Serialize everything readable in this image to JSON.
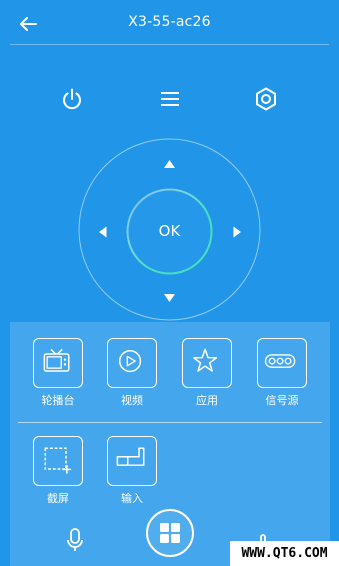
{
  "header": {
    "title": "X3-55-ac26"
  },
  "top_controls": [
    {
      "name": "power-icon"
    },
    {
      "name": "menu-icon"
    },
    {
      "name": "settings-icon"
    }
  ],
  "dpad": {
    "ok_label": "OK"
  },
  "shortcuts": [
    {
      "icon": "tv-icon",
      "label": "轮播台"
    },
    {
      "icon": "video-icon",
      "label": "视频"
    },
    {
      "icon": "star-icon",
      "label": "应用"
    },
    {
      "icon": "signal-source-icon",
      "label": "信号源"
    },
    {
      "icon": "screenshot-icon",
      "label": "截屏"
    },
    {
      "icon": "input-icon",
      "label": "输入"
    }
  ],
  "bottom_bar": {
    "left": "microphone-icon",
    "center": "home-grid-icon",
    "right": "touch-icon"
  },
  "watermark": {
    "text": "WWW.QT6.COM"
  },
  "colors": {
    "background": "#2196e9",
    "ok_ring": "#46e0c0"
  }
}
